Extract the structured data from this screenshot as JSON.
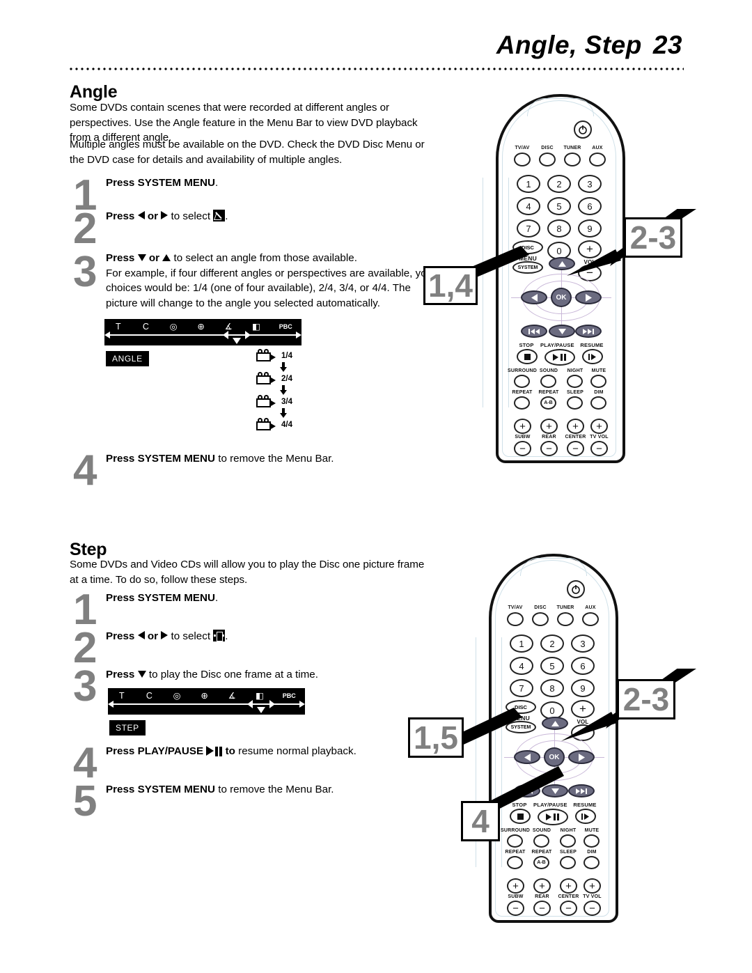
{
  "header": {
    "title": "Angle, Step",
    "page_number": "23"
  },
  "angle_section": {
    "heading": "Angle",
    "paragraphs": [
      "Some DVDs contain scenes that were recorded at different angles or perspectives. Use the Angle feature in the Menu Bar to view DVD playback from a different angle.",
      "Multiple angles must be available on the DVD. Check the DVD Disc Menu or the DVD case for details and availability of multiple angles."
    ],
    "steps": [
      {
        "num": "1",
        "html": "<b>Press SYSTEM MENU</b>."
      },
      {
        "num": "2",
        "html": "<b>Press</b> <span class=\"tri-l\"></span> <b>or</b> <span class=\"tri-r\"></span> to select <span class=\"ic ic-angle\"></span>."
      },
      {
        "num": "3",
        "html": "<b>Press</b> <span class=\"tri-d\"></span> <b>or</b> <span class=\"tri-u\"></span> to select an angle from those available.<br>For example, if four different angles or perspectives are available, your choices would be: 1/4 (one of four available), 2/4, 3/4, or 4/4. The picture will change to the angle you selected automatically."
      },
      {
        "num": "4",
        "html": "<b>Press SYSTEM MENU</b> to remove the Menu Bar."
      }
    ],
    "osd": {
      "icons": [
        "T",
        "C",
        "repeat-spiral-icon",
        "zoom-icon",
        "angle-icon",
        "step-icon",
        "PBC"
      ],
      "icon_labels": [
        "T",
        "C",
        "◎",
        "⊕",
        "∡",
        "◧",
        "PBC"
      ],
      "selected_icon_index": 4,
      "badge": "ANGLE",
      "angle_options": [
        "1/4",
        "2/4",
        "3/4",
        "4/4"
      ]
    }
  },
  "step_section": {
    "heading": "Step",
    "paragraphs": [
      "Some DVDs and Video CDs will allow you to play the Disc one picture frame at a time. To do so, follow these steps."
    ],
    "steps": [
      {
        "num": "1",
        "html": "<b>Press SYSTEM MENU</b>."
      },
      {
        "num": "2",
        "html": "<b>Press</b> <span class=\"tri-l\"></span> <b>or</b> <span class=\"tri-r\"></span> to select <span class=\"ic ic-step\"></span>."
      },
      {
        "num": "3",
        "html": "<b>Press</b> <span class=\"tri-d\"></span> to play the Disc one frame at a time."
      },
      {
        "num": "4",
        "html": "<b>Press PLAY/PAUSE</b> <span class=\"pp-glyph\"><span class=\"p1\"></span><span class=\"p2\"></span><span class=\"p3\"></span></span> <b>to</b> resume normal playback."
      },
      {
        "num": "5",
        "html": "<b>Press SYSTEM MENU</b> to remove the Menu Bar."
      }
    ],
    "osd": {
      "icon_labels": [
        "T",
        "C",
        "◎",
        "⊕",
        "∡",
        "◧",
        "PBC"
      ],
      "selected_icon_index": 5,
      "badge": "STEP"
    }
  },
  "remote": {
    "power_label": "power-icon",
    "source_buttons": [
      "TV/AV",
      "DISC",
      "TUNER",
      "AUX"
    ],
    "keypad": [
      "1",
      "2",
      "3",
      "4",
      "5",
      "6",
      "7",
      "8",
      "9",
      "0"
    ],
    "disc_menu_label_1": "DISC",
    "disc_menu_label_2": "MENU",
    "system_label": "SYSTEM",
    "vol_plus": "+",
    "vol_label": "VOL",
    "vol_minus": "−",
    "ok_label": "OK",
    "transport_labels": [
      "STOP",
      "PLAY/PAUSE",
      "RESUME"
    ],
    "audio_row_1": [
      "SURROUND",
      "SOUND",
      "NIGHT",
      "MUTE"
    ],
    "audio_row_2": [
      "REPEAT",
      "REPEAT",
      "SLEEP",
      "DIM"
    ],
    "repeat_ab": "A-B",
    "level_labels": [
      "SUBW",
      "REAR",
      "CENTER",
      "TV VOL"
    ],
    "level_plus": "+",
    "level_minus": "−"
  },
  "callouts": {
    "angle_remote": [
      {
        "text": "1,4",
        "name": "callout-1-4"
      },
      {
        "text": "2-3",
        "name": "callout-2-3-angle"
      }
    ],
    "step_remote": [
      {
        "text": "1,5",
        "name": "callout-1-5"
      },
      {
        "text": "2-3",
        "name": "callout-2-3-step"
      },
      {
        "text": "4",
        "name": "callout-4"
      }
    ]
  }
}
